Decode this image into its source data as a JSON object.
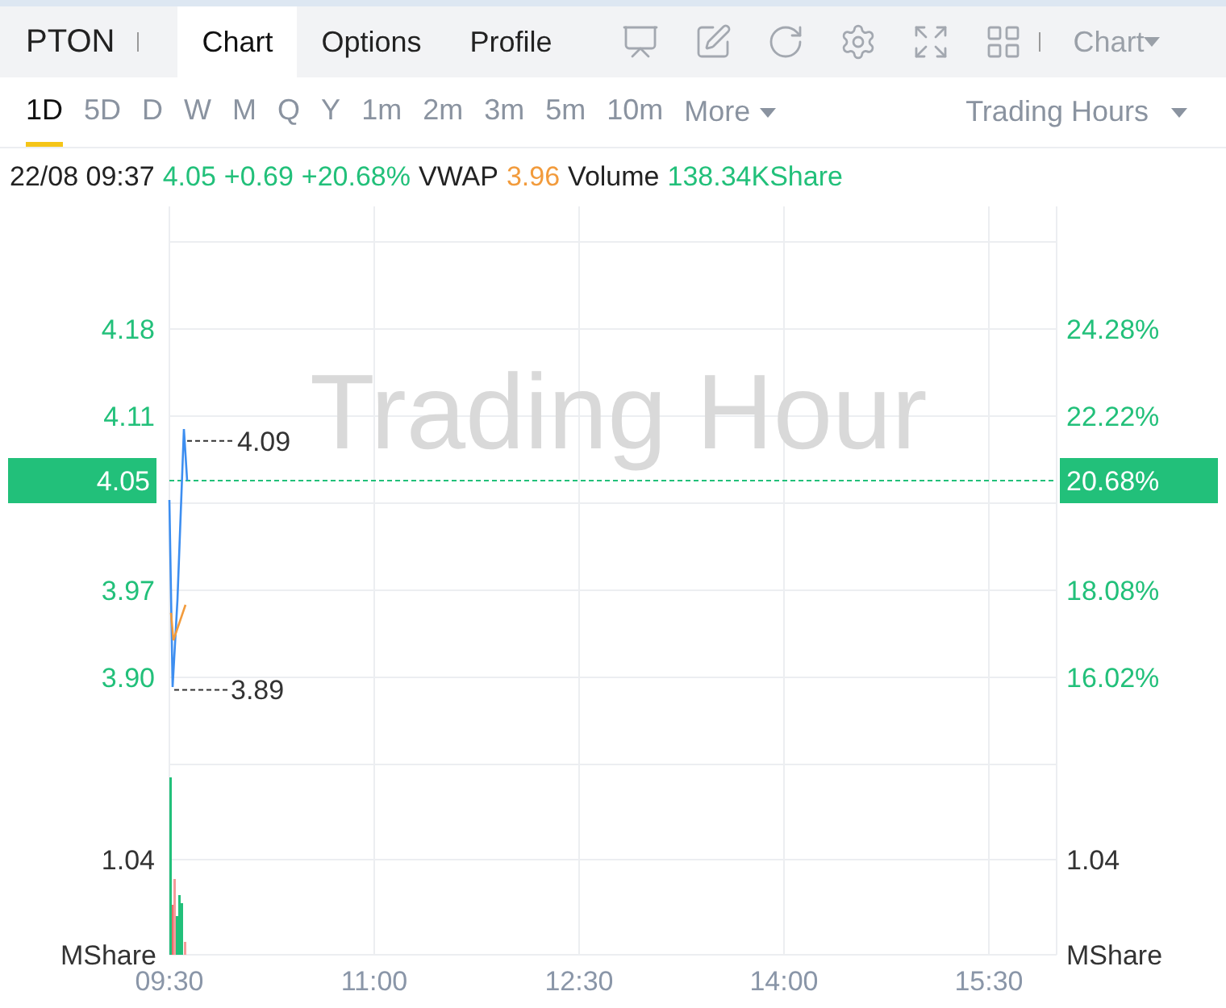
{
  "header": {
    "symbol": "PTON",
    "tabs": [
      {
        "label": "Chart",
        "selected": true
      },
      {
        "label": "Options",
        "selected": false
      },
      {
        "label": "Profile",
        "selected": false
      }
    ],
    "chart_menu": "Chart"
  },
  "periods": [
    {
      "label": "1D",
      "selected": true
    },
    {
      "label": "5D",
      "selected": false
    },
    {
      "label": "D",
      "selected": false
    },
    {
      "label": "W",
      "selected": false
    },
    {
      "label": "M",
      "selected": false
    },
    {
      "label": "Q",
      "selected": false
    },
    {
      "label": "Y",
      "selected": false
    },
    {
      "label": "1m",
      "selected": false
    },
    {
      "label": "2m",
      "selected": false
    },
    {
      "label": "3m",
      "selected": false
    },
    {
      "label": "5m",
      "selected": false
    },
    {
      "label": "10m",
      "selected": false
    }
  ],
  "more_menu": "More",
  "session_menu": "Trading Hours",
  "quote": {
    "time": "22/08 09:37",
    "price": "4.05",
    "change": "+0.69",
    "change_pct": "+20.68%",
    "vwap_label": "VWAP",
    "vwap": "3.96",
    "volume_label": "Volume",
    "volume": "138.34KShare"
  },
  "chart": {
    "watermark": "Trading Hour",
    "right_labels": [
      "24.28%",
      "22.22%",
      "18.08%",
      "16.02%"
    ],
    "last_price": "4.05",
    "last_pct": "20.68%",
    "high": "4.09",
    "low": "3.89",
    "volume_axis": {
      "left_value": "1.04",
      "right_value": "1.04",
      "left_unit": "MShare",
      "right_unit": "MShare"
    },
    "price_labels": [
      "4.18",
      "4.11",
      "3.97",
      "3.90"
    ],
    "time_labels": [
      "09:30",
      "11:00",
      "12:30",
      "14:00",
      "15:30"
    ]
  }
}
